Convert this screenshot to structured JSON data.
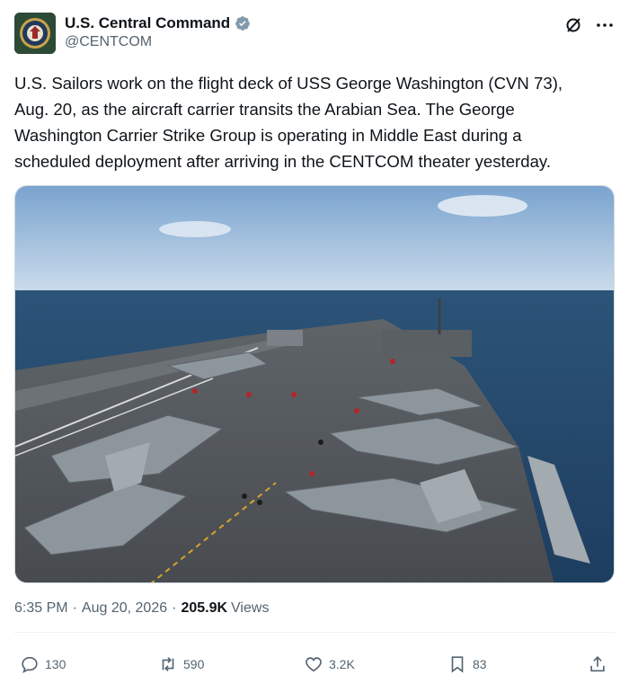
{
  "author": {
    "display_name": "U.S. Central Command",
    "handle": "@CENTCOM"
  },
  "tweet": {
    "text": "U.S. Sailors work on the flight deck of USS George Washington (CVN 73),\nAug. 20, as the aircraft carrier transits the Arabian Sea. The George\nWashington Carrier Strike Group is operating in Middle East during a\nscheduled deployment after arriving in the CENTCOM theater yesterday."
  },
  "meta": {
    "time": "6:35 PM",
    "date": "Aug 20, 2026",
    "separator": "·",
    "views_count": "205.9K",
    "views_label": "Views"
  },
  "actions": {
    "replies": "130",
    "reposts": "590",
    "likes": "3.2K",
    "bookmarks": "83"
  },
  "colors": {
    "text_primary": "#0f1419",
    "text_secondary": "#536471",
    "verified": "#829aab",
    "divider": "#eff3f4"
  },
  "icons": {
    "verified": "verified-badge-icon",
    "grok": "grok-icon",
    "more": "more-dots-icon",
    "reply": "reply-icon",
    "repost": "repost-icon",
    "like": "heart-icon",
    "bookmark": "bookmark-icon",
    "share": "share-icon"
  }
}
